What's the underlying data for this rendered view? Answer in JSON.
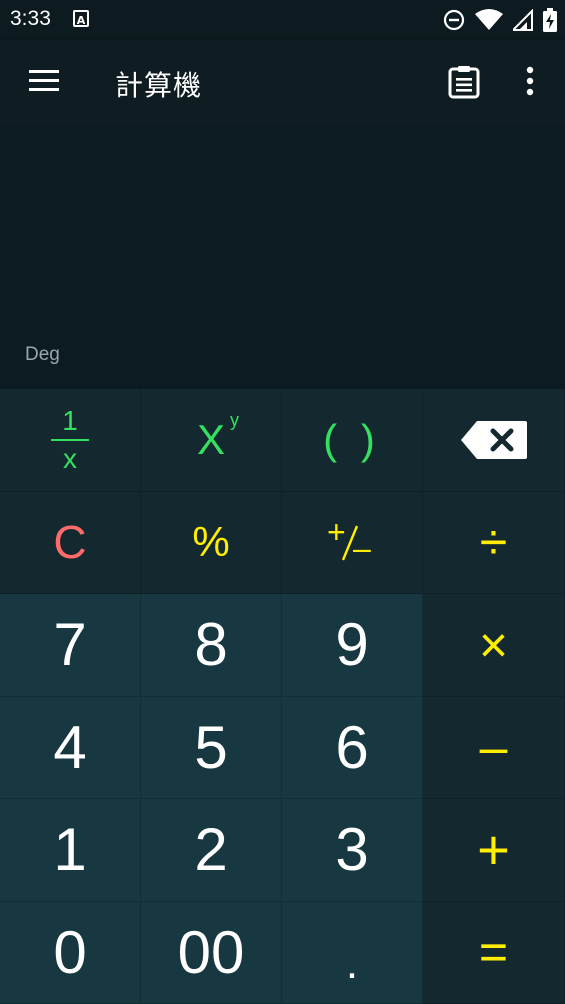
{
  "status_bar": {
    "time": "3:33",
    "notification_icon": "A",
    "icons": [
      "do-not-disturb-icon",
      "wifi-icon",
      "signal-icon",
      "battery-charging-icon"
    ]
  },
  "app_bar": {
    "title": "計算機",
    "icons": [
      "menu-icon",
      "clipboard-icon",
      "more-vert-icon"
    ]
  },
  "display": {
    "mode": "Deg"
  },
  "keypad": {
    "row1": {
      "reciprocal_num": "1",
      "reciprocal_den": "x",
      "power_base": "X",
      "power_exp": "y",
      "parens": "( )",
      "backspace": "backspace-icon"
    },
    "row2": {
      "clear": "C",
      "percent": "%",
      "plus_minus_plus": "+",
      "plus_minus_minus": "–",
      "divide": "÷"
    },
    "row3": {
      "k7": "7",
      "k8": "8",
      "k9": "9",
      "multiply": "×"
    },
    "row4": {
      "k4": "4",
      "k5": "5",
      "k6": "6",
      "subtract": "–"
    },
    "row5": {
      "k1": "1",
      "k2": "2",
      "k3": "3",
      "add": "+"
    },
    "row6": {
      "k0": "0",
      "k00": "00",
      "dot": ".",
      "equals": "="
    }
  },
  "colors": {
    "background": "#0c1b21",
    "function_key": "#13282f",
    "number_key": "#183841",
    "accent_green": "#35e060",
    "accent_yellow": "#ffee00",
    "clear_red": "#ff6b6b"
  }
}
